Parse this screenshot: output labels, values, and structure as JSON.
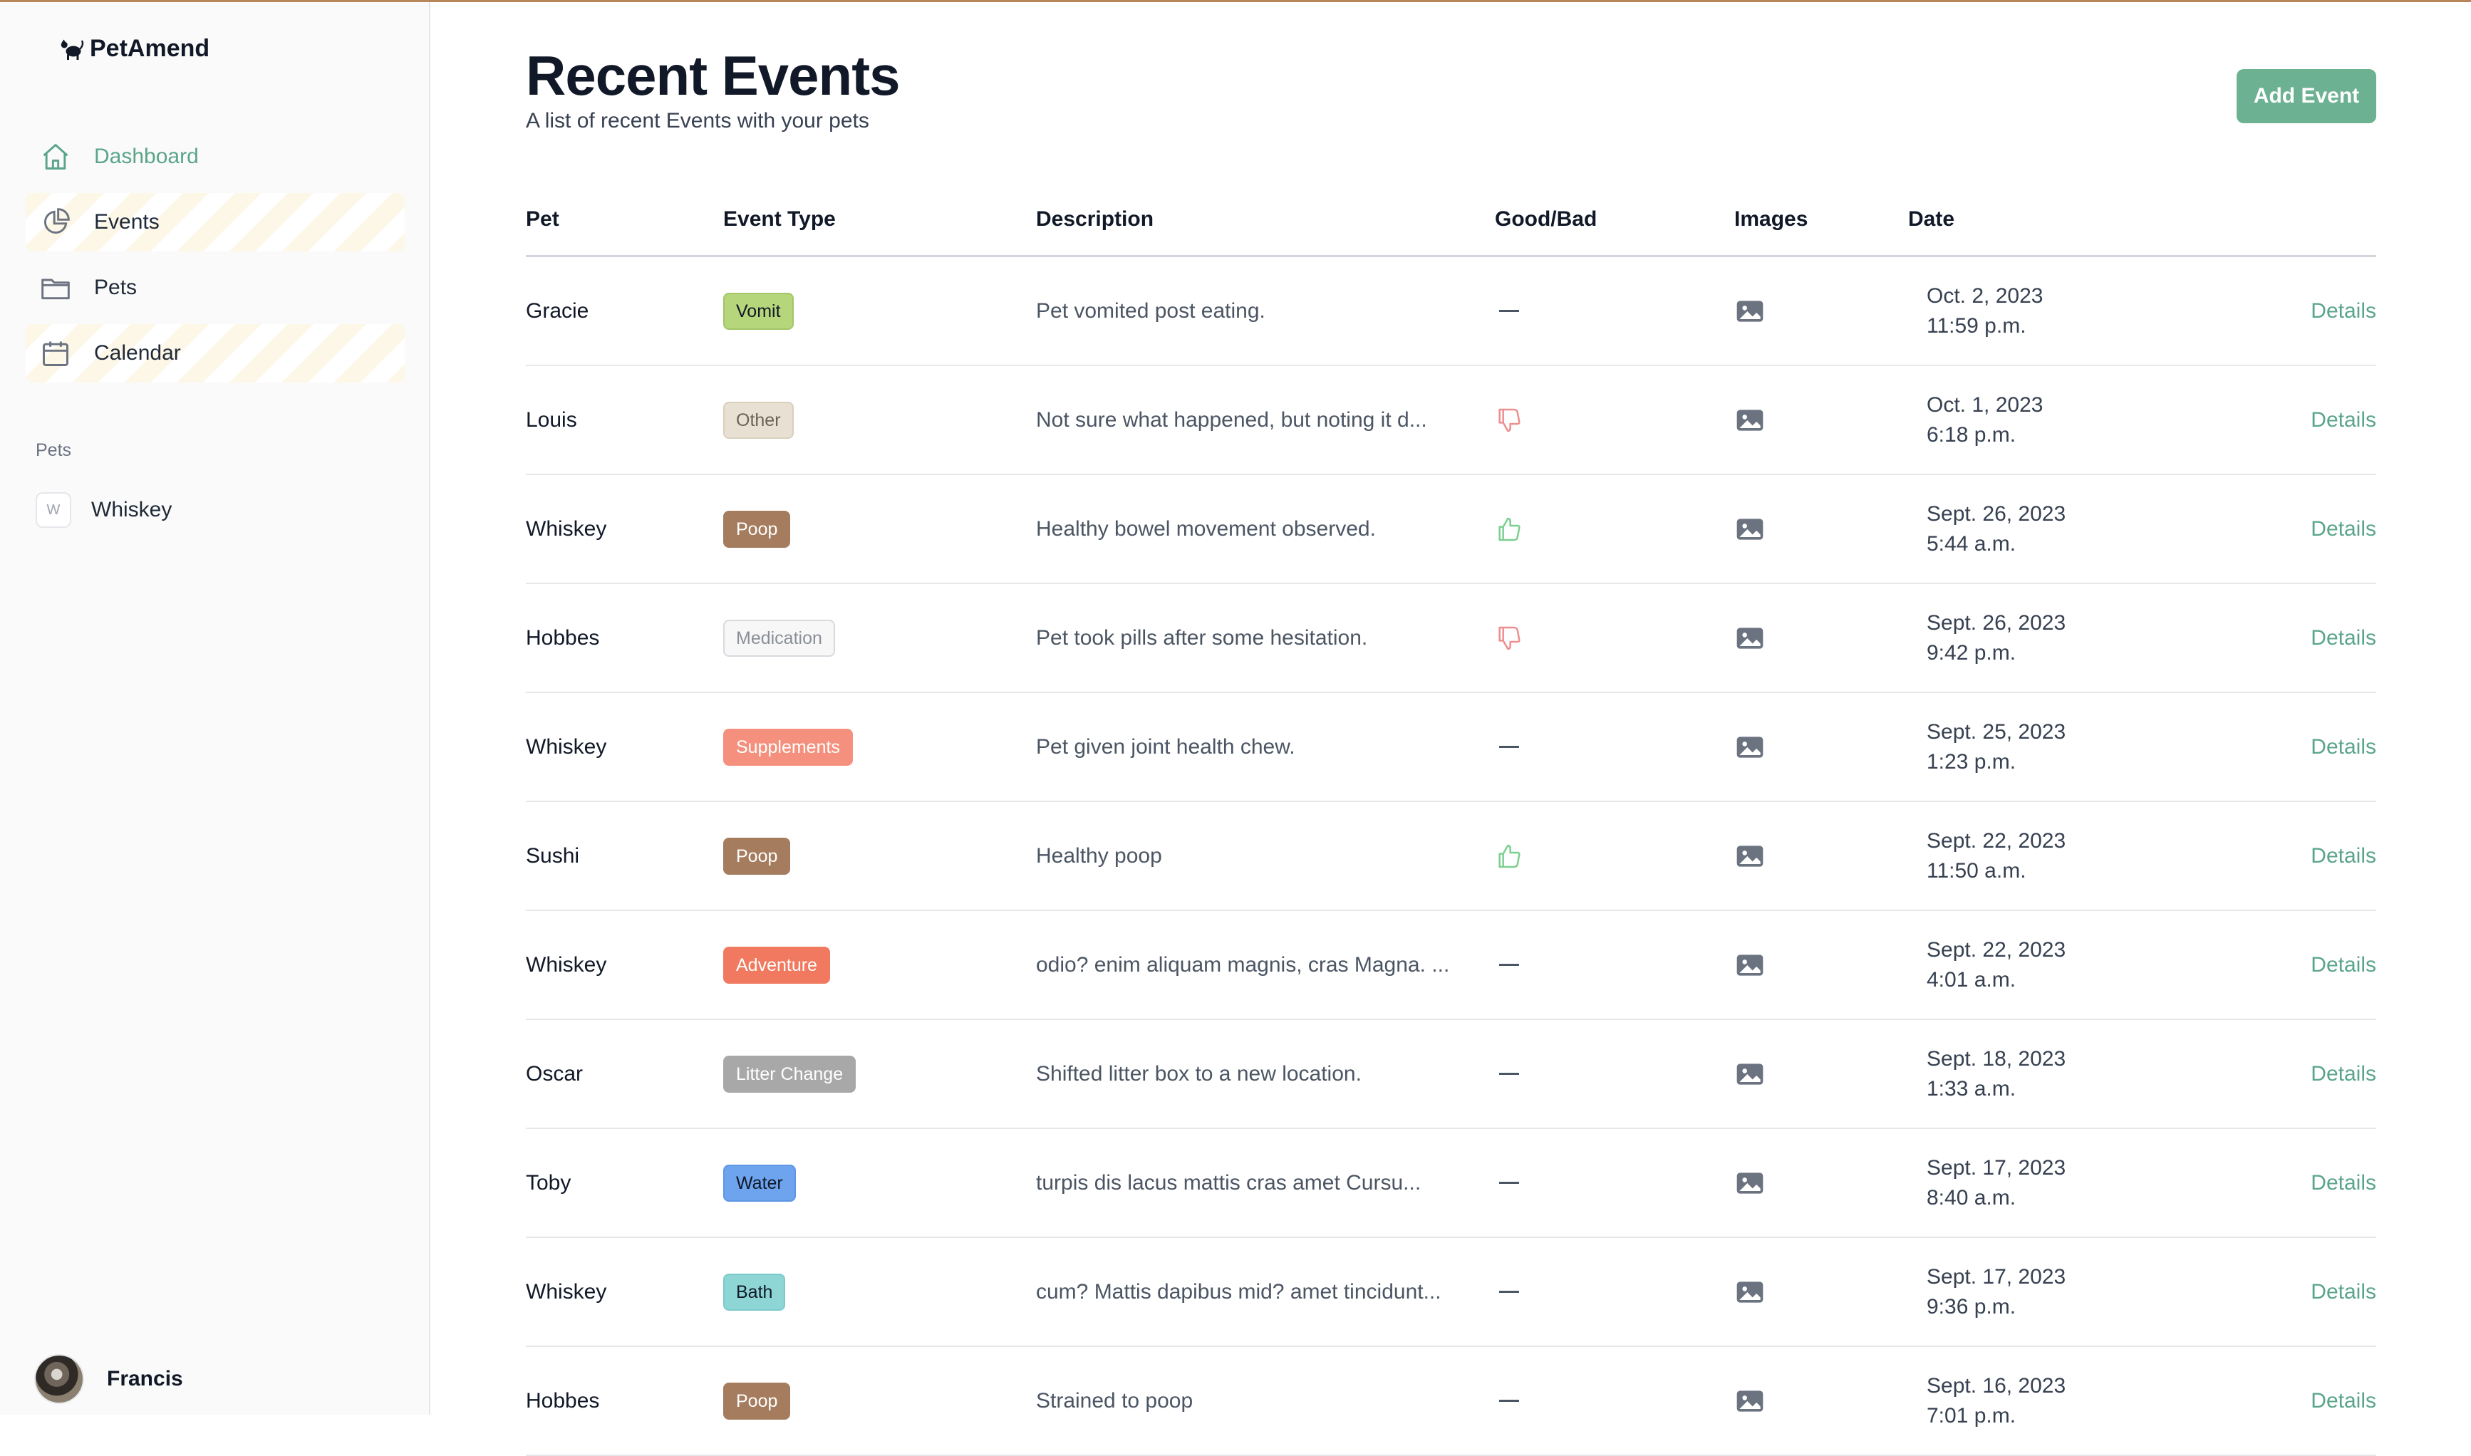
{
  "app": {
    "brand": "PetAmend"
  },
  "sidebar": {
    "nav": [
      {
        "label": "Dashboard",
        "icon": "home-icon"
      },
      {
        "label": "Events",
        "icon": "pie-chart-icon"
      },
      {
        "label": "Pets",
        "icon": "folder-icon"
      },
      {
        "label": "Calendar",
        "icon": "calendar-icon"
      }
    ],
    "pets_section_label": "Pets",
    "pets": [
      {
        "initial": "W",
        "name": "Whiskey"
      }
    ],
    "user": {
      "name": "Francis"
    }
  },
  "header": {
    "title": "Recent Events",
    "subtitle": "A list of recent Events with your pets",
    "add_button_label": "Add Event"
  },
  "table": {
    "columns": [
      "Pet",
      "Event Type",
      "Description",
      "Good/Bad",
      "Images",
      "Date"
    ],
    "details_label": "Details",
    "rows": [
      {
        "pet": "Gracie",
        "type": "Vomit",
        "type_bg": "#b5d67a",
        "type_fg": "#111827",
        "type_border": "#a3c566",
        "description": "Pet vomited post eating.",
        "good_bad": "neutral",
        "date_line1": "Oct. 2, 2023",
        "date_line2": "11:59 p.m."
      },
      {
        "pet": "Louis",
        "type": "Other",
        "type_bg": "#e8e1d3",
        "type_fg": "#6b6355",
        "type_border": "#d9cfbd",
        "description": "Not sure what happened, but noting it d...",
        "good_bad": "bad",
        "date_line1": "Oct. 1, 2023",
        "date_line2": "6:18 p.m."
      },
      {
        "pet": "Whiskey",
        "type": "Poop",
        "type_bg": "#a57d5e",
        "type_fg": "#ffffff",
        "type_border": "#a57d5e",
        "description": "Healthy bowel movement observed.",
        "good_bad": "good",
        "date_line1": "Sept. 26, 2023",
        "date_line2": "5:44 a.m."
      },
      {
        "pet": "Hobbes",
        "type": "Medication",
        "type_bg": "#f7f7f8",
        "type_fg": "#8a8f98",
        "type_border": "#d7dadf",
        "description": "Pet took pills after some hesitation.",
        "good_bad": "bad",
        "date_line1": "Sept. 26, 2023",
        "date_line2": "9:42 p.m."
      },
      {
        "pet": "Whiskey",
        "type": "Supplements",
        "type_bg": "#f4907d",
        "type_fg": "#ffffff",
        "type_border": "#f4907d",
        "description": "Pet given joint health chew.",
        "good_bad": "neutral",
        "date_line1": "Sept. 25, 2023",
        "date_line2": "1:23 p.m."
      },
      {
        "pet": "Sushi",
        "type": "Poop",
        "type_bg": "#a57d5e",
        "type_fg": "#ffffff",
        "type_border": "#a57d5e",
        "description": "Healthy poop",
        "good_bad": "good",
        "date_line1": "Sept. 22, 2023",
        "date_line2": "11:50 a.m."
      },
      {
        "pet": "Whiskey",
        "type": "Adventure",
        "type_bg": "#f0795f",
        "type_fg": "#ffffff",
        "type_border": "#f0795f",
        "description": "odio? enim aliquam magnis, cras Magna. ...",
        "good_bad": "neutral",
        "date_line1": "Sept. 22, 2023",
        "date_line2": "4:01 a.m."
      },
      {
        "pet": "Oscar",
        "type": "Litter Change",
        "type_bg": "#a8a8a8",
        "type_fg": "#ffffff",
        "type_border": "#a8a8a8",
        "description": "Shifted litter box to a new location.",
        "good_bad": "neutral",
        "date_line1": "Sept. 18, 2023",
        "date_line2": "1:33 a.m."
      },
      {
        "pet": "Toby",
        "type": "Water",
        "type_bg": "#6ea4ee",
        "type_fg": "#111827",
        "type_border": "#5e96e6",
        "description": "turpis dis lacus mattis cras amet Cursu...",
        "good_bad": "neutral",
        "date_line1": "Sept. 17, 2023",
        "date_line2": "8:40 a.m."
      },
      {
        "pet": "Whiskey",
        "type": "Bath",
        "type_bg": "#8ed6d6",
        "type_fg": "#111827",
        "type_border": "#7ccaca",
        "description": "cum? Mattis dapibus mid? amet tincidunt...",
        "good_bad": "neutral",
        "date_line1": "Sept. 17, 2023",
        "date_line2": "9:36 p.m."
      },
      {
        "pet": "Hobbes",
        "type": "Poop",
        "type_bg": "#a57d5e",
        "type_fg": "#ffffff",
        "type_border": "#a57d5e",
        "description": "Strained to poop",
        "good_bad": "neutral",
        "date_line1": "Sept. 16, 2023",
        "date_line2": "7:01 p.m."
      }
    ]
  },
  "colors": {
    "accent": "#5aa58a",
    "good": "#7ccf8f",
    "bad": "#ee8e8e",
    "brand_bar": "#b8865a"
  }
}
